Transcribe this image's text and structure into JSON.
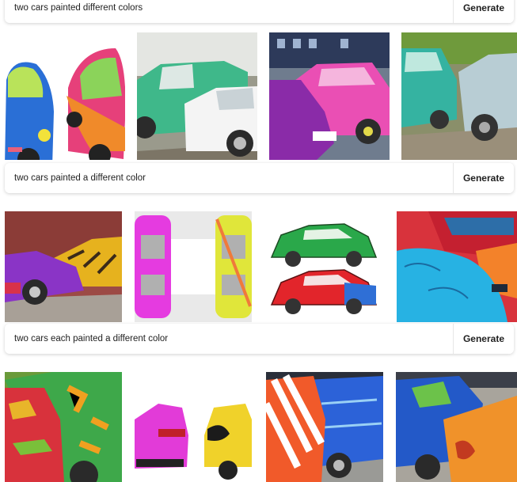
{
  "rows": [
    {
      "prompt": "two cars painted different colors",
      "button": "Generate",
      "images": [
        {
          "alt": "Two cartoon cars, one blue and one pink/orange, on a white background"
        },
        {
          "alt": "Green car parked next to a white car"
        },
        {
          "alt": "Purple car next to a pink car in a parking lot"
        },
        {
          "alt": "Teal car next to a pale blue car on grass"
        }
      ]
    },
    {
      "prompt": "two cars painted a different color",
      "button": "Generate",
      "images": [
        {
          "alt": "Purple car and tiger-striped yellow car in front of a garage"
        },
        {
          "alt": "Top view of a magenta car and a yellow car"
        },
        {
          "alt": "Illustration of a green car above a red car"
        },
        {
          "alt": "Red car and a blue car with orange graffiti"
        }
      ]
    },
    {
      "prompt": "two cars each painted a different color",
      "button": "Generate",
      "images": [
        {
          "alt": "Close-up of red and green camouflage painted cars"
        },
        {
          "alt": "Magenta car and yellow car on a white background"
        },
        {
          "alt": "Orange and white striped car next to a blue car"
        },
        {
          "alt": "Blue car with green paint next to an orange car"
        }
      ]
    }
  ],
  "colors": {
    "accent": "#1f1f1f",
    "bar_bg": "#ffffff"
  }
}
